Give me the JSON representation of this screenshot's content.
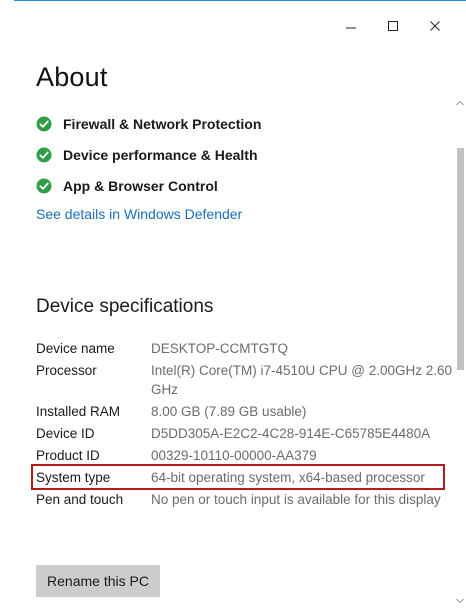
{
  "window": {
    "minimize_label": "Minimize",
    "maximize_label": "Maximize",
    "close_label": "Close"
  },
  "page": {
    "title": "About"
  },
  "security_status": {
    "items": [
      {
        "label": "Firewall & Network Protection",
        "status_color": "#2e9e45"
      },
      {
        "label": "Device performance & Health",
        "status_color": "#2e9e45"
      },
      {
        "label": "App & Browser Control",
        "status_color": "#2e9e45"
      }
    ],
    "link_label": "See details in Windows Defender"
  },
  "device_specifications": {
    "title": "Device specifications",
    "rows": [
      {
        "label": "Device name",
        "value": "DESKTOP-CCMTGTQ"
      },
      {
        "label": "Processor",
        "value": "Intel(R) Core(TM) i7-4510U CPU @ 2.00GHz 2.60 GHz"
      },
      {
        "label": "Installed RAM",
        "value": "8.00 GB (7.89 GB usable)"
      },
      {
        "label": "Device ID",
        "value": "D5DD305A-E2C2-4C28-914E-C65785E4480A"
      },
      {
        "label": "Product ID",
        "value": "00329-10110-00000-AA379"
      },
      {
        "label": "System type",
        "value": "64-bit operating system, x64-based processor"
      },
      {
        "label": "Pen and touch",
        "value": "No pen or touch input is available for this display"
      }
    ],
    "highlight_color": "#b11b1b"
  },
  "actions": {
    "rename_label": "Rename this PC"
  },
  "colors": {
    "accent": "#1f8de0",
    "link": "#1a6fb5",
    "check_green": "#2e9e45"
  }
}
